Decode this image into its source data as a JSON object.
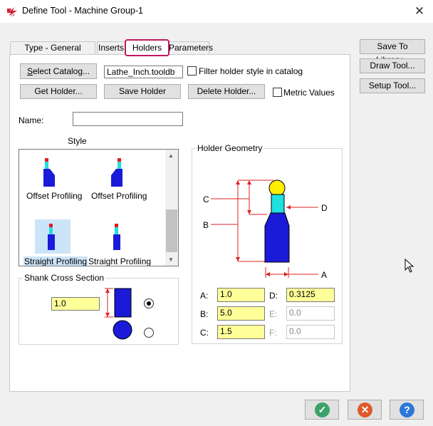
{
  "window": {
    "title": "Define Tool - Machine Group-1"
  },
  "tabs": [
    "Type - General Turning",
    "Inserts",
    "Holders",
    "Parameters"
  ],
  "buttons": {
    "select_catalog": "Select Catalog...",
    "get_holder": "Get Holder...",
    "save_holder": "Save Holder",
    "delete_holder": "Delete Holder..."
  },
  "catalog_field": "Lathe_Inch.tooldb",
  "checkboxes": {
    "filter": "Filter holder style in catalog",
    "metric": "Metric Values"
  },
  "name": {
    "label": "Name:",
    "value": ""
  },
  "style": {
    "title": "Style",
    "items": [
      "Offset Profiling",
      "Offset Profiling",
      "Straight Profiling",
      "Straight Profiling"
    ]
  },
  "shank": {
    "title": "Shank Cross Section",
    "value": "1.0"
  },
  "geometry": {
    "title": "Holder Geometry",
    "diagram_labels": [
      "C",
      "B",
      "D",
      "A"
    ],
    "fields": [
      {
        "label": "A:",
        "value": "1.0",
        "enabled": true
      },
      {
        "label": "D:",
        "value": "0.3125",
        "enabled": true
      },
      {
        "label": "B:",
        "value": "5.0",
        "enabled": true
      },
      {
        "label": "E:",
        "value": "0.0",
        "enabled": false
      },
      {
        "label": "C:",
        "value": "1.5",
        "enabled": true
      },
      {
        "label": "F:",
        "value": "0.0",
        "enabled": false
      }
    ]
  },
  "side_buttons": [
    "Save To Library...",
    "Draw Tool...",
    "Setup Tool..."
  ],
  "colors": {
    "accent_tab_border": "#c0185f",
    "field_yellow": "#ffff99",
    "ok_green": "#3aa36b",
    "cancel_red": "#e0592a",
    "help_blue": "#2b78d6"
  },
  "icons": {
    "ok": "check-icon",
    "cancel": "x-icon",
    "help": "question-icon"
  }
}
